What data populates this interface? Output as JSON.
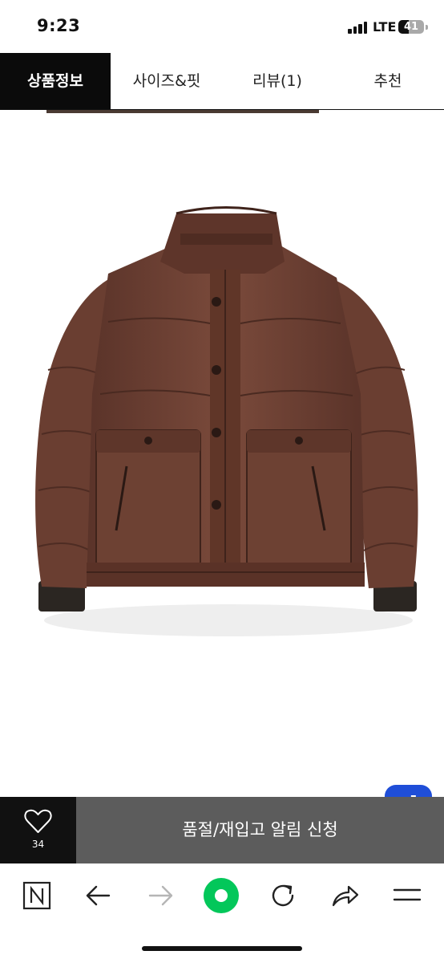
{
  "status_bar": {
    "time": "9:23",
    "network": "LTE",
    "battery_level": "41"
  },
  "tabs": [
    {
      "label": "상품정보",
      "active": true
    },
    {
      "label": "사이즈&핏",
      "active": false
    },
    {
      "label": "리뷰(1)",
      "active": false
    },
    {
      "label": "추천",
      "active": false
    }
  ],
  "product": {
    "image_icon": "brown-puffer-jacket-image",
    "jacket_color": "#6b3f32"
  },
  "floating": {
    "d_label": "d",
    "d_color": "#1f4ed8",
    "scroll_top_icon": "arrow-up-icon"
  },
  "action_bar": {
    "like_count": "34",
    "restock_label": "품절/재입고 알림 신청"
  },
  "toolbar": {
    "icons": [
      "naver-n-icon",
      "back-arrow-icon",
      "forward-arrow-icon",
      "green-dot-icon",
      "refresh-icon",
      "share-icon",
      "menu-icon"
    ],
    "accent": "#03c75a"
  }
}
